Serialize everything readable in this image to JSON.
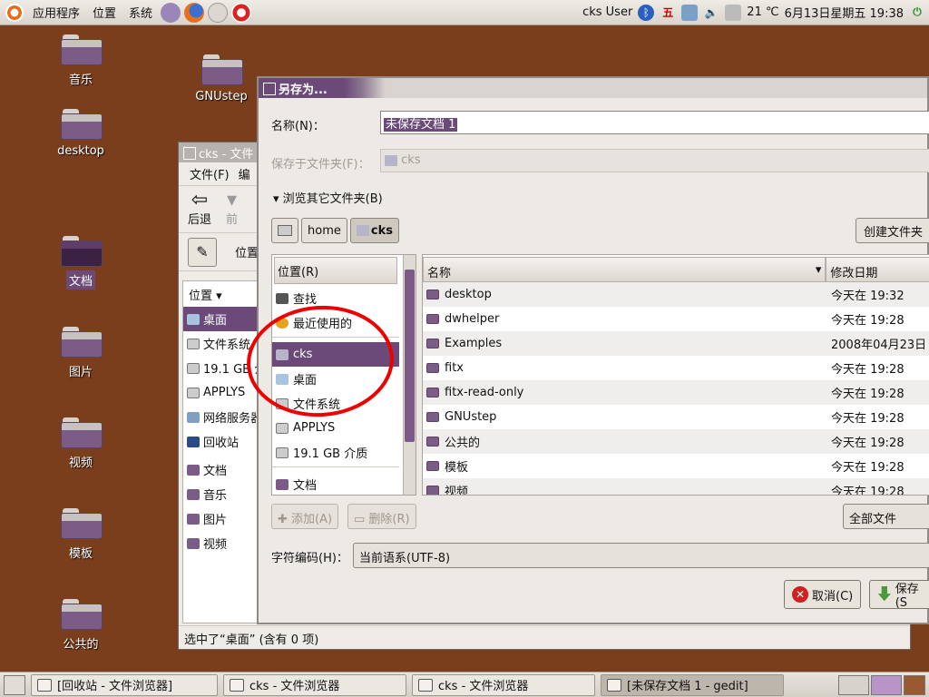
{
  "top_panel": {
    "menus": [
      "应用程序",
      "位置",
      "系统"
    ],
    "user": "cks User",
    "input_method": "五",
    "weather": "21 ℃",
    "datetime": "6月13日星期五 19:38"
  },
  "desktop_icons": [
    {
      "label": "音乐"
    },
    {
      "label": "desktop"
    },
    {
      "label": "文档"
    },
    {
      "label": "图片"
    },
    {
      "label": "视频"
    },
    {
      "label": "模板"
    },
    {
      "label": "公共的"
    },
    {
      "label": "GNUstep"
    }
  ],
  "file_browser": {
    "title": "cks - 文件",
    "menu": [
      "文件(F)",
      "编"
    ],
    "toolbar": {
      "back": "后退",
      "forward": "前"
    },
    "location_label": "位置",
    "side_header": "位置 ▾",
    "side_items": [
      "桌面",
      "文件系统",
      "19.1 GB 介",
      "APPLYS",
      "网络服务器",
      "回收站",
      "文档",
      "音乐",
      "图片",
      "视频"
    ],
    "status": "选中了“桌面” (含有 0 项)"
  },
  "save_dialog": {
    "title": "另存为...",
    "name_label": "名称(N)：",
    "name_value": "未保存文档 1",
    "save_in_label": "保存于文件夹(F)：",
    "save_in_value": "cks",
    "browse_label": "浏览其它文件夹(B)",
    "path": [
      "home",
      "cks"
    ],
    "create_folder": "创建文件夹",
    "places_header": "位置(R)",
    "places": [
      "查找",
      "最近使用的",
      "cks",
      "桌面",
      "文件系统",
      "APPLYS",
      "19.1 GB 介质"
    ],
    "bookmarks": [
      "文档",
      "音乐"
    ],
    "files_header": {
      "name": "名称",
      "modified": "修改日期"
    },
    "files": [
      {
        "name": "desktop",
        "modified": "今天在 19:32"
      },
      {
        "name": "dwhelper",
        "modified": "今天在 19:28"
      },
      {
        "name": "Examples",
        "modified": "2008年04月23日"
      },
      {
        "name": "fitx",
        "modified": "今天在 19:28"
      },
      {
        "name": "fitx-read-only",
        "modified": "今天在 19:28"
      },
      {
        "name": "GNUstep",
        "modified": "今天在 19:28"
      },
      {
        "name": "公共的",
        "modified": "今天在 19:28"
      },
      {
        "name": "模板",
        "modified": "今天在 19:28"
      },
      {
        "name": "视频",
        "modified": "今天在 19:28"
      }
    ],
    "add_button": "添加(A)",
    "remove_button": "删除(R)",
    "filter": "全部文件",
    "encoding_label": "字符编码(H)：",
    "encoding_value": "当前语系(UTF-8)",
    "cancel_button": "取消(C)",
    "save_button": "保存(S"
  },
  "taskbar": [
    {
      "label": "[回收站 - 文件浏览器]"
    },
    {
      "label": "cks - 文件浏览器"
    },
    {
      "label": "cks - 文件浏览器"
    },
    {
      "label": "[未保存文档 1 - gedit]"
    }
  ]
}
